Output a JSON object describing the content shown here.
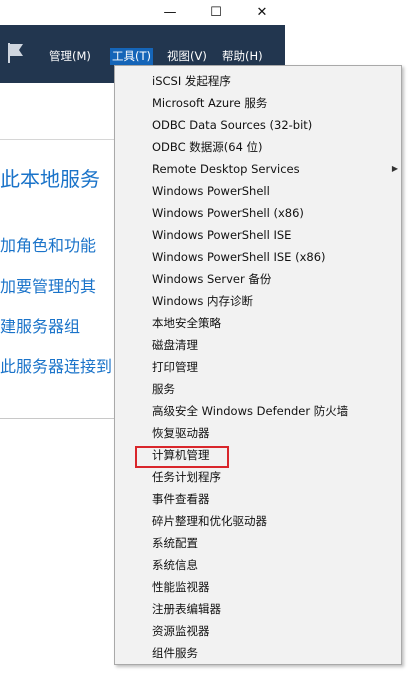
{
  "window": {
    "minimize_glyph": "—",
    "maximize_glyph": "☐",
    "close_glyph": "✕"
  },
  "menubar": {
    "items": [
      {
        "label": "管理(M)"
      },
      {
        "label": "工具(T)"
      },
      {
        "label": "视图(V)"
      },
      {
        "label": "帮助(H)"
      }
    ],
    "active_index": 1
  },
  "pane": {
    "heading": "此本地服务",
    "links": [
      "加角色和功能",
      "加要管理的其",
      "建服务器组",
      "此服务器连接到"
    ]
  },
  "tools_menu": {
    "items": [
      {
        "label": "iSCSI 发起程序"
      },
      {
        "label": "Microsoft Azure 服务"
      },
      {
        "label": "ODBC Data Sources (32-bit)"
      },
      {
        "label": "ODBC 数据源(64 位)"
      },
      {
        "label": "Remote Desktop Services",
        "has_submenu": true,
        "submenu_glyph": "▶"
      },
      {
        "label": "Windows PowerShell"
      },
      {
        "label": "Windows PowerShell (x86)"
      },
      {
        "label": "Windows PowerShell ISE"
      },
      {
        "label": "Windows PowerShell ISE (x86)"
      },
      {
        "label": "Windows Server 备份"
      },
      {
        "label": "Windows 内存诊断"
      },
      {
        "label": "本地安全策略"
      },
      {
        "label": "磁盘清理"
      },
      {
        "label": "打印管理"
      },
      {
        "label": "服务"
      },
      {
        "label": "高级安全 Windows Defender 防火墙"
      },
      {
        "label": "恢复驱动器"
      },
      {
        "label": "计算机管理",
        "highlighted": true
      },
      {
        "label": "任务计划程序"
      },
      {
        "label": "事件查看器"
      },
      {
        "label": "碎片整理和优化驱动器"
      },
      {
        "label": "系统配置"
      },
      {
        "label": "系统信息"
      },
      {
        "label": "性能监视器"
      },
      {
        "label": "注册表编辑器"
      },
      {
        "label": "资源监视器"
      },
      {
        "label": "组件服务"
      }
    ]
  },
  "colors": {
    "menubar_bg": "#22364f",
    "active_menu_bg": "#1565b8",
    "link_blue": "#1a73c9",
    "highlight_border": "#d9262b"
  }
}
